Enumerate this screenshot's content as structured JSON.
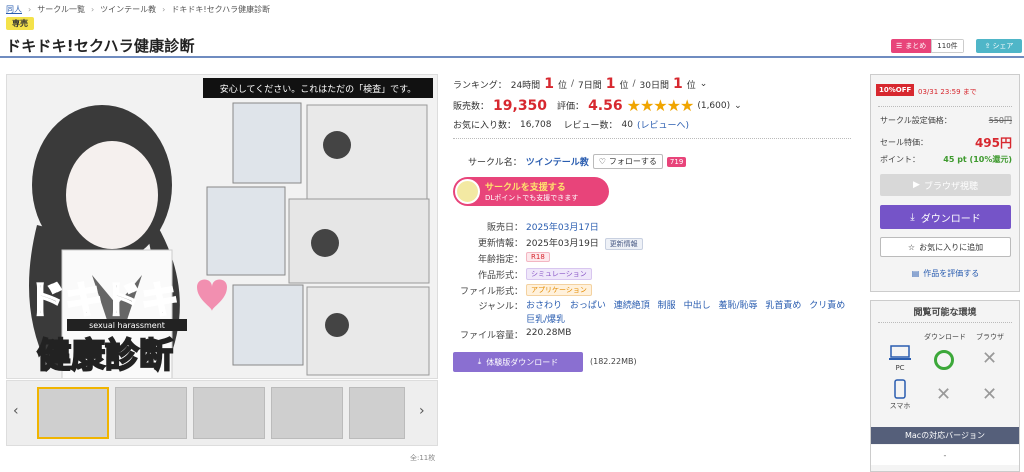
{
  "breadcrumb": [
    "同人",
    "サークル一覧",
    "ツインテール教",
    "ドキドキ!セクハラ健康診断"
  ],
  "badge": "専売",
  "title": "ドキドキ!セクハラ健康診断",
  "header_actions": {
    "matome_label": "まとめ",
    "matome_count": "110件",
    "share_label": "シェア"
  },
  "image": {
    "banner_text": "安心してください。これはただの「検査」です。",
    "logo_line1": "ドキドキ",
    "logo_line2": "sexual harassment",
    "logo_line3": "健康診断",
    "count": "全:11枚"
  },
  "ranking": {
    "label": "ランキング：",
    "items": [
      {
        "period": "24時間",
        "rank": "1",
        "unit": "位"
      },
      {
        "period": "7日間",
        "rank": "1",
        "unit": "位"
      },
      {
        "period": "30日間",
        "rank": "1",
        "unit": "位"
      }
    ]
  },
  "sales": {
    "label": "販売数：",
    "value": "19,350"
  },
  "rating": {
    "label": "評価：",
    "value": "4.56",
    "stars": "★★★★★",
    "count": "(1,600)",
    "score": 4.56
  },
  "favorites": {
    "label": "お気に入り数：",
    "value": "16,708"
  },
  "reviews": {
    "label": "レビュー数：",
    "value": "40",
    "link": "(レビューへ)"
  },
  "circle": {
    "label": "サークル名：",
    "name": "ツインテール教",
    "follow": "フォローする",
    "follow_count": "719"
  },
  "support": {
    "line1": "サークルを支援する",
    "line2": "DLポイントでも支援できます"
  },
  "specs": {
    "release_label": "販売日：",
    "release": "2025年03月17日",
    "updated_label": "更新情報：",
    "updated": "2025年03月19日",
    "updated_tag": "更新情報",
    "age_label": "年齢指定：",
    "age": "R18",
    "type_label": "作品形式：",
    "type": "シミュレーション",
    "format_label": "ファイル形式：",
    "format": "アプリケーション",
    "genre_label": "ジャンル：",
    "genres": [
      "おさわり",
      "おっぱい",
      "連続絶頂",
      "制服",
      "中出し",
      "羞恥/恥辱",
      "乳首責め",
      "クリ責め",
      "巨乳/爆乳"
    ],
    "size_label": "ファイル容量：",
    "size": "220.28MB"
  },
  "trial": {
    "label": "体験版ダウンロード",
    "size": "(182.22MB)"
  },
  "price": {
    "discount_badge": "10%OFF",
    "until": "03/31 23:59 まで",
    "list_label": "サークル設定価格：",
    "list": "550円",
    "sale_label": "セール特価：",
    "sale": "495円",
    "point_label": "ポイント：",
    "point": "45 pt (10%還元)"
  },
  "buttons": {
    "browser": "ブラウザ視聴",
    "download": "ダウンロード",
    "favorite": "お気に入りに追加",
    "rate": "作品を評価する"
  },
  "environment": {
    "title": "閲覧可能な環境",
    "col_download": "ダウンロード",
    "col_browser": "ブラウザ",
    "pc": "PC",
    "phone": "スマホ",
    "mac_head": "Macの対応バージョン",
    "mac_value": "-"
  }
}
